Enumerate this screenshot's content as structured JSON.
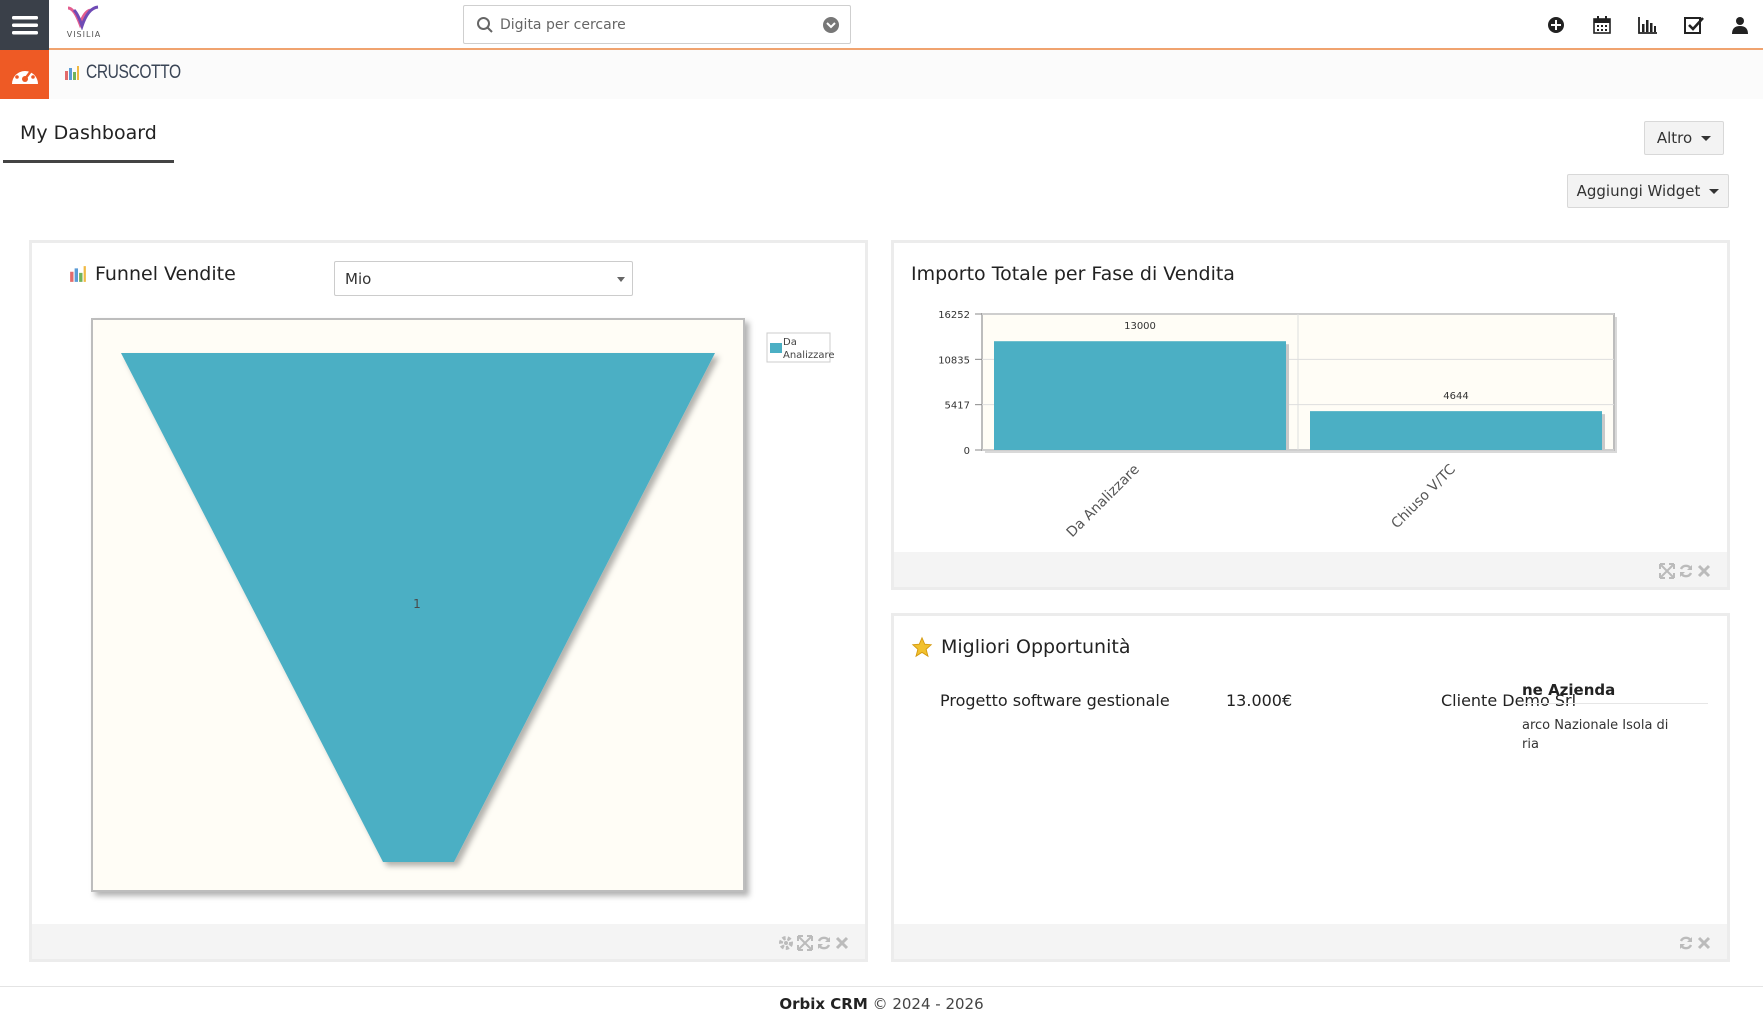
{
  "header": {
    "logo_text": "VISILIA",
    "search_placeholder": "Digita per cercare"
  },
  "module": {
    "title": "CRUSCOTTO"
  },
  "tabs": [
    {
      "label": "My Dashboard"
    }
  ],
  "buttons": {
    "altro": "Altro",
    "aggiungi_widget": "Aggiungi Widget"
  },
  "funnel_widget": {
    "title": "Funnel Vendite",
    "filter_value": "Mio",
    "legend_label_line1": "Da",
    "legend_label_line2": "Analizzare",
    "funnel_label": "1",
    "colors": {
      "fill": "#4bafc4",
      "plot_bg": "#fffdf6"
    }
  },
  "bar_widget": {
    "title": "Importo Totale per Fase di Vendita",
    "chart_data": {
      "type": "bar",
      "categories": [
        "Da Analizzare",
        "Chiuso V/TC"
      ],
      "values": [
        13000,
        4644
      ],
      "yticks": [
        0,
        5417,
        10835,
        16252
      ],
      "ylim": [
        0,
        16252
      ],
      "grid": true,
      "color": "#4bafc4"
    }
  },
  "opportunities_widget": {
    "title": "Migliori Opportunità",
    "row": {
      "name": "Progetto software gestionale",
      "amount": "13.000€",
      "client": "Cliente Demo Srl"
    },
    "overlay": {
      "header": "ne Azienda",
      "line1": "arco Nazionale Isola di",
      "line2": "ria"
    }
  },
  "footer": {
    "brand": "Orbix CRM",
    "copyright": "© 2024 - 2026"
  }
}
